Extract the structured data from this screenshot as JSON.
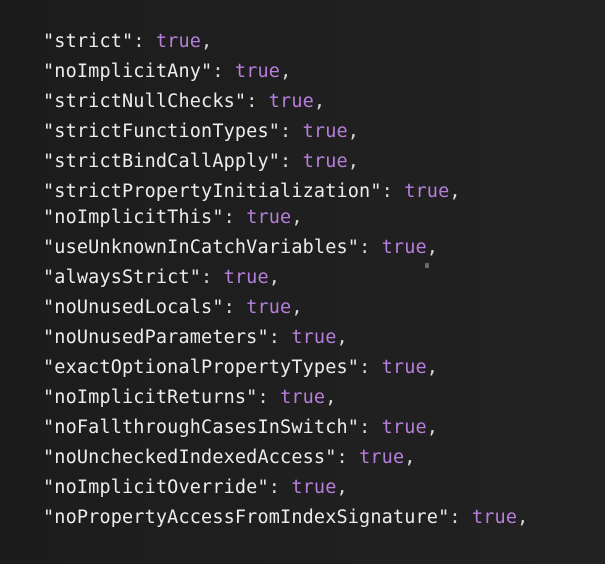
{
  "editor": {
    "lines": [
      {
        "key": "\"strict\"",
        "sep": ": ",
        "value": "true",
        "end": ","
      },
      {
        "key": "\"noImplicitAny\"",
        "sep": ": ",
        "value": "true",
        "end": ","
      },
      {
        "key": "\"strictNullChecks\"",
        "sep": ": ",
        "value": "true",
        "end": ","
      },
      {
        "key": "\"strictFunctionTypes\"",
        "sep": ": ",
        "value": "true",
        "end": ","
      },
      {
        "key": "\"strictBindCallApply\"",
        "sep": ": ",
        "value": "true",
        "end": ","
      },
      {
        "key": "\"strictPropertyInitialization\"",
        "sep": ": ",
        "value": "true",
        "end": ","
      },
      {
        "key": "\"noImplicitThis\"",
        "sep": ": ",
        "value": "true",
        "end": ","
      },
      {
        "key": "\"useUnknownInCatchVariables\"",
        "sep": ": ",
        "value": "true",
        "end": ","
      },
      {
        "key": "\"alwaysStrict\"",
        "sep": ": ",
        "value": "true",
        "end": ","
      },
      {
        "key": "\"noUnusedLocals\"",
        "sep": ": ",
        "value": "true",
        "end": ","
      },
      {
        "key": "\"noUnusedParameters\"",
        "sep": ": ",
        "value": "true",
        "end": ","
      },
      {
        "key": "\"exactOptionalPropertyTypes\"",
        "sep": ": ",
        "value": "true",
        "end": ","
      },
      {
        "key": "\"noImplicitReturns\"",
        "sep": ": ",
        "value": "true",
        "end": ","
      },
      {
        "key": "\"noFallthroughCasesInSwitch\"",
        "sep": ": ",
        "value": "true",
        "end": ","
      },
      {
        "key": "\"noUncheckedIndexedAccess\"",
        "sep": ": ",
        "value": "true",
        "end": ","
      },
      {
        "key": "\"noImplicitOverride\"",
        "sep": ": ",
        "value": "true",
        "end": ","
      },
      {
        "key": "\"noPropertyAccessFromIndexSignature\"",
        "sep": ": ",
        "value": "true",
        "end": ","
      }
    ]
  },
  "colors": {
    "background": "#1e1e1e",
    "key": "#ececec",
    "boolean": "#b77fdb",
    "punctuation": "#d8d8d8"
  },
  "icons": {
    "cursor": "mouse-pointer-dot"
  }
}
